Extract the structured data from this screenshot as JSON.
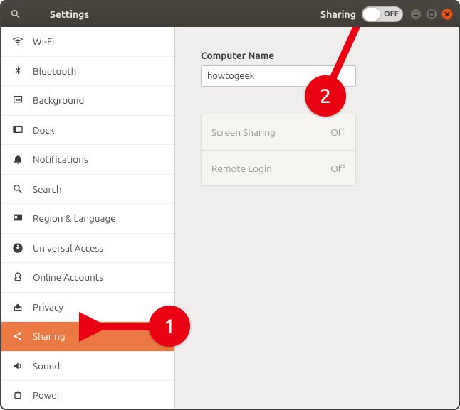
{
  "titlebar": {
    "app_title": "Settings",
    "header_label": "Sharing",
    "toggle_state": "OFF"
  },
  "sidebar": {
    "items": [
      {
        "icon": "wifi-icon",
        "label": "Wi-Fi"
      },
      {
        "icon": "bluetooth-icon",
        "label": "Bluetooth"
      },
      {
        "icon": "background-icon",
        "label": "Background"
      },
      {
        "icon": "dock-icon",
        "label": "Dock"
      },
      {
        "icon": "notifications-icon",
        "label": "Notifications"
      },
      {
        "icon": "search-icon",
        "label": "Search"
      },
      {
        "icon": "region-language-icon",
        "label": "Region & Language"
      },
      {
        "icon": "universal-access-icon",
        "label": "Universal Access"
      },
      {
        "icon": "online-accounts-icon",
        "label": "Online Accounts"
      },
      {
        "icon": "privacy-icon",
        "label": "Privacy"
      },
      {
        "icon": "sharing-icon",
        "label": "Sharing"
      },
      {
        "icon": "sound-icon",
        "label": "Sound"
      },
      {
        "icon": "power-icon",
        "label": "Power"
      }
    ],
    "selected_index": 10
  },
  "main": {
    "computer_name_label": "Computer Name",
    "computer_name_value": "howtogeek",
    "options": [
      {
        "label": "Screen Sharing",
        "state": "Off"
      },
      {
        "label": "Remote Login",
        "state": "Off"
      }
    ]
  },
  "annotations": {
    "a1": "1",
    "a2": "2"
  }
}
